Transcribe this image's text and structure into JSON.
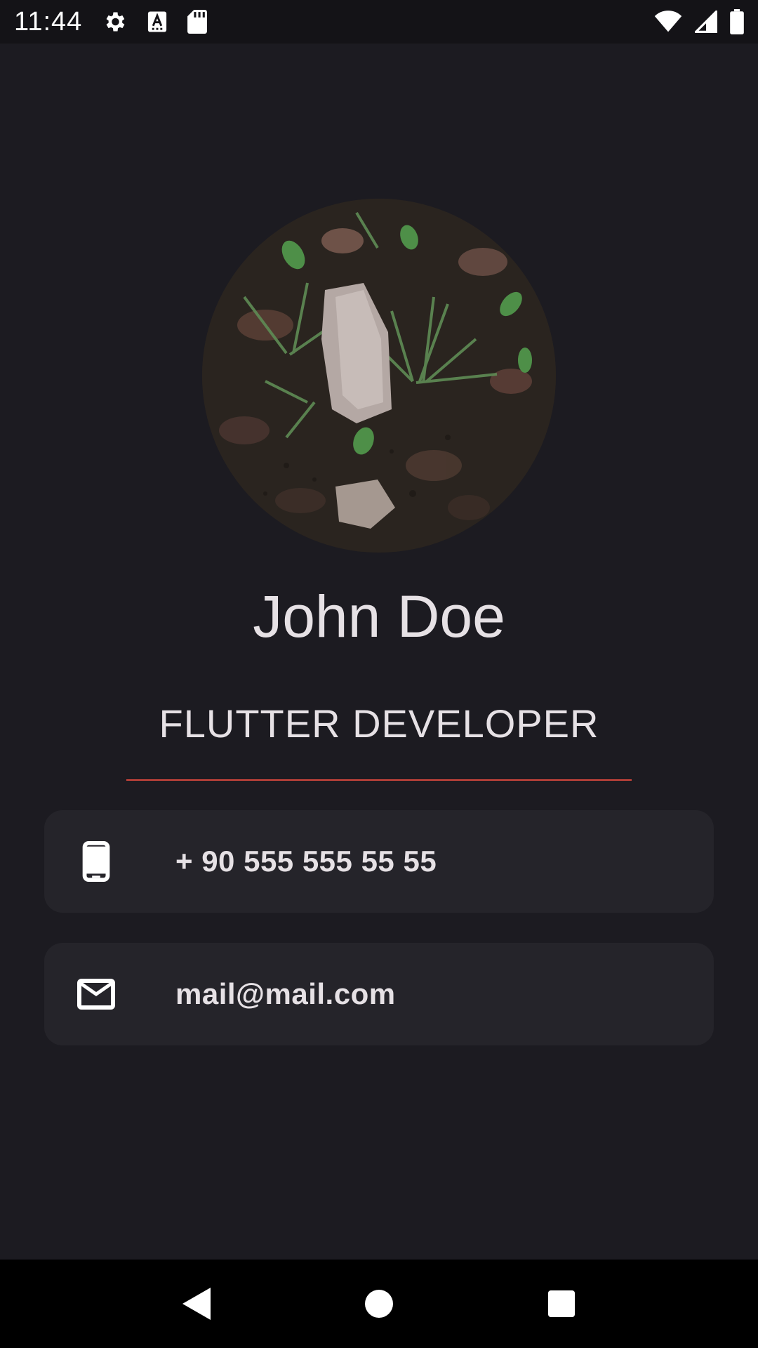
{
  "status_bar": {
    "time": "11:44",
    "icons_left": [
      "settings-icon",
      "text-a-icon",
      "sd-card-icon"
    ],
    "icons_right": [
      "wifi-icon",
      "signal-icon",
      "battery-icon"
    ]
  },
  "profile": {
    "name": "John Doe",
    "title": "FLUTTER DEVELOPER"
  },
  "contacts": {
    "phone": {
      "icon": "phone-icon",
      "value": "+ 90 555 555 55 55"
    },
    "email": {
      "icon": "mail-icon",
      "value": "mail@mail.com"
    }
  },
  "colors": {
    "background": "#1c1b21",
    "card": "#25242a",
    "divider": "#d2463c",
    "text": "#e6e1e5"
  },
  "nav_bar": {
    "buttons": [
      "back-icon",
      "home-icon",
      "recents-icon"
    ]
  }
}
